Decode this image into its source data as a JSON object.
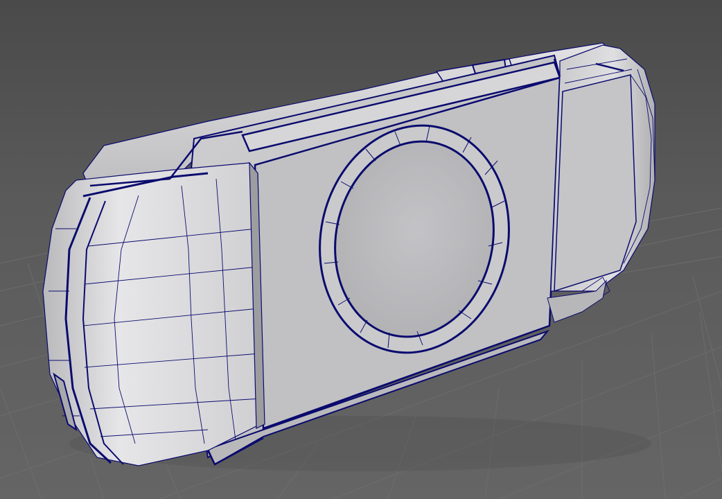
{
  "viewport": {
    "view": "perspective",
    "colors": {
      "background": "#5d5d5d",
      "grid_line": "#6c6c6c",
      "mesh_surface": "#c2c2c4",
      "mesh_highlight": "#e8e8ea",
      "mesh_shadow": "#8d8d90",
      "wireframe": "#0a0a6e",
      "selected_edge": "#1a1aa0"
    }
  },
  "model": {
    "object": "handheld-console-body",
    "display_mode": "wireframe-on-shaded",
    "selected": true,
    "parts": [
      "left-grip",
      "right-grip",
      "back-panel",
      "circular-disc-window",
      "top-shoulder-rail",
      "front-bezel-strip"
    ]
  }
}
